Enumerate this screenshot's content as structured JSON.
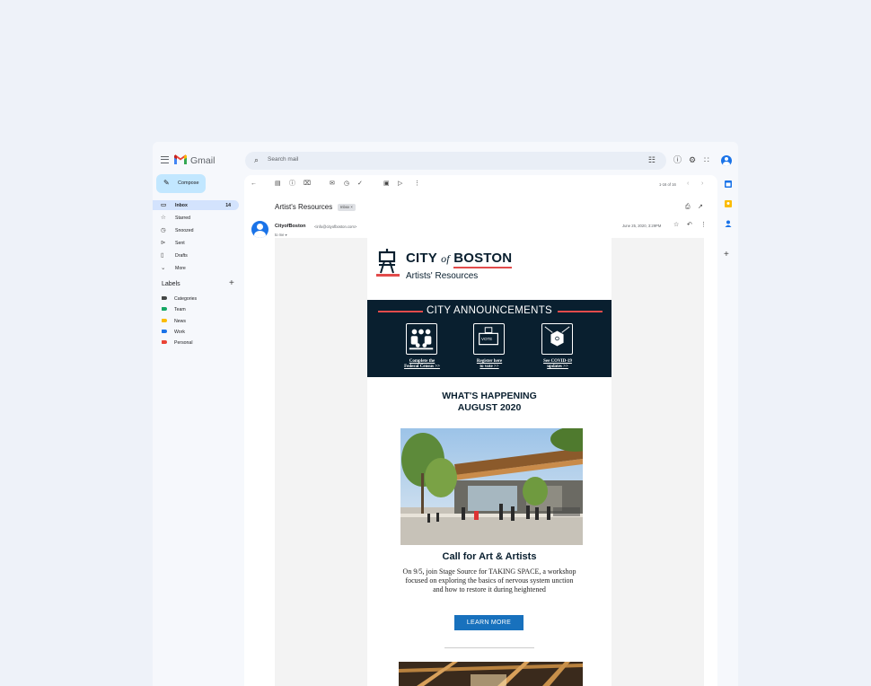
{
  "app": {
    "brand": "Gmail",
    "search_placeholder": "Search mail"
  },
  "compose_label": "Compose",
  "nav": [
    {
      "label": "Inbox",
      "count": "14",
      "icon": "inbox-icon"
    },
    {
      "label": "Starred",
      "count": "",
      "icon": "star-icon"
    },
    {
      "label": "Snoozed",
      "count": "",
      "icon": "clock-icon"
    },
    {
      "label": "Sent",
      "count": "",
      "icon": "send-icon"
    },
    {
      "label": "Drafts",
      "count": "",
      "icon": "draft-icon"
    },
    {
      "label": "More",
      "count": "",
      "icon": "chevron-down-icon"
    }
  ],
  "labels": {
    "header": "Labels",
    "items": [
      {
        "label": "Categories",
        "color": "#444746"
      },
      {
        "label": "Team",
        "color": "#16a765"
      },
      {
        "label": "News",
        "color": "#fbbc04"
      },
      {
        "label": "Work",
        "color": "#1a73e8"
      },
      {
        "label": "Personal",
        "color": "#ea4335"
      }
    ]
  },
  "message": {
    "pager": "1-16 of 16",
    "subject": "Artist's Resources",
    "chip": "Inbox ×",
    "sender_name": "CityofBoston",
    "sender_email": "<info@cityofboston.com>",
    "to": "to me ▾",
    "date": "June 25, 2020, 3:29PM"
  },
  "email": {
    "title_city": "CITY",
    "title_of": "of",
    "title_boston": "BOSTON",
    "subtitle": "Artists' Resources",
    "announce_title": "CITY ANNOUNCEMENTS",
    "vote_badge": "VOTE",
    "links": [
      {
        "line1": "Complete the",
        "line2": "Federal Census >>"
      },
      {
        "line1": "Register here",
        "line2": "to vote >>"
      },
      {
        "line1": "See COVID-19",
        "line2": "updates >>"
      }
    ],
    "happening_line1": "WHAT'S HAPPENING",
    "happening_line2": "AUGUST 2020",
    "call_title": "Call for Art & Artists",
    "call_desc": "On 9/5, join Stage Source for TAKING SPACE, a workshop focused on exploring the basics of nervous system unction and how to restore it during heightened",
    "cta": "LEARN MORE"
  },
  "colors": {
    "accent": "#1a73e8",
    "compose_bg": "#c2e7ff",
    "boston_navy": "#091f2f",
    "boston_red": "#e24b4b",
    "button_blue": "#1871bd"
  }
}
